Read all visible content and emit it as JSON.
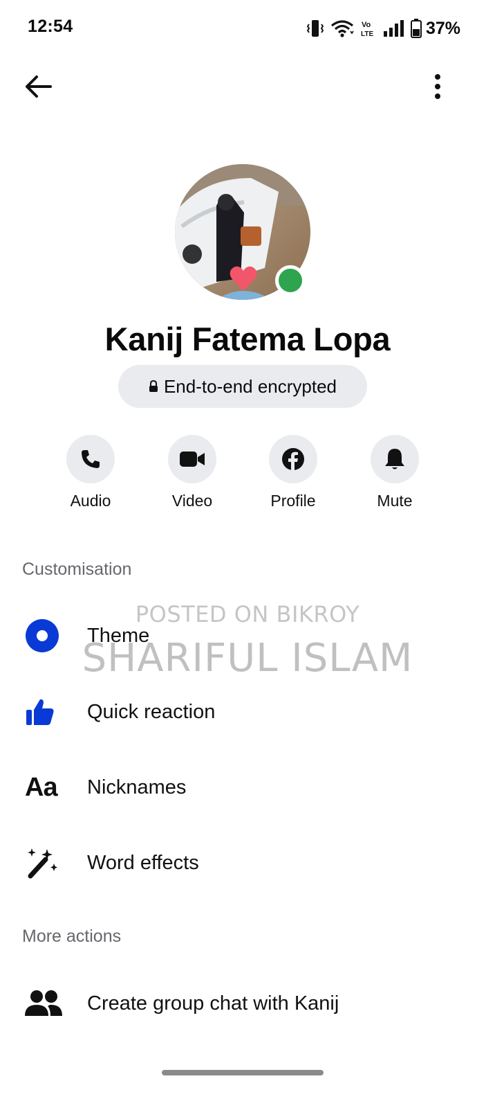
{
  "status_bar": {
    "time": "12:54",
    "battery": "37%",
    "network": "Vo LTE",
    "icons": [
      "vibrate-icon",
      "wifi-icon",
      "volte-icon",
      "signal-icon",
      "battery-icon"
    ]
  },
  "header": {
    "back_icon": "back-arrow-icon",
    "more_icon": "more-vertical-icon"
  },
  "profile": {
    "name": "Kanij Fatema Lopa",
    "encryption_label": "End-to-end encrypted",
    "online": true,
    "online_color": "#2ea44f"
  },
  "actions": [
    {
      "label": "Audio",
      "icon": "phone-icon"
    },
    {
      "label": "Video",
      "icon": "video-camera-icon"
    },
    {
      "label": "Profile",
      "icon": "facebook-icon"
    },
    {
      "label": "Mute",
      "icon": "bell-icon"
    }
  ],
  "customisation": {
    "heading": "Customisation",
    "items": [
      {
        "label": "Theme",
        "icon": "theme-icon"
      },
      {
        "label": "Quick reaction",
        "icon": "thumbs-up-icon"
      },
      {
        "label": "Nicknames",
        "icon": "nicknames-icon"
      },
      {
        "label": "Word effects",
        "icon": "word-effects-icon"
      }
    ]
  },
  "more_actions": {
    "heading": "More actions",
    "items": [
      {
        "label": "Create group chat with Kanij",
        "icon": "group-icon"
      }
    ]
  },
  "watermark": {
    "line1": "POSTED ON BIKROY",
    "line2": "SHARIFUL ISLAM"
  },
  "colors": {
    "accent_blue": "#0a3ad6",
    "chip_bg": "#e9ebee",
    "section_gray": "#65676b"
  }
}
